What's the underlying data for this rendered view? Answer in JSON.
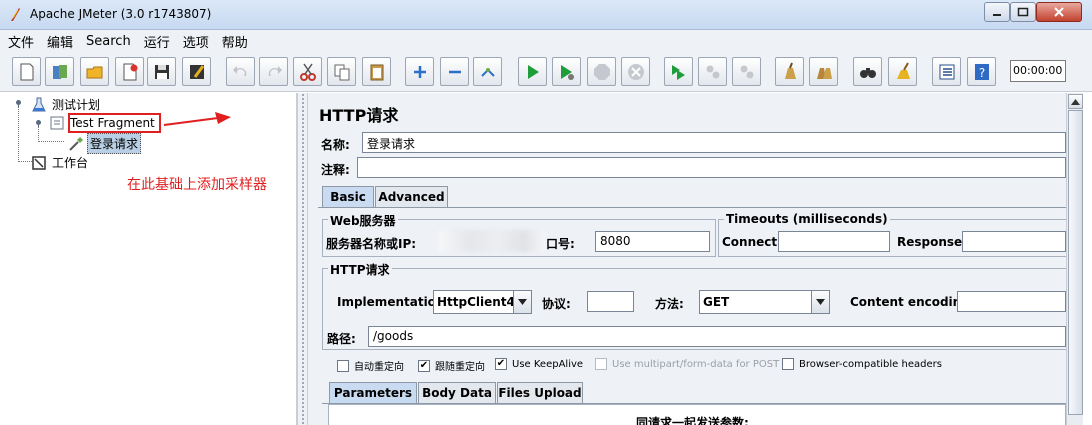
{
  "window": {
    "title": "Apache JMeter (3.0 r1743807)"
  },
  "menu": [
    "文件",
    "编辑",
    "Search",
    "运行",
    "选项",
    "帮助"
  ],
  "toolbar": {
    "timer": "00:00:00"
  },
  "tree": {
    "root": "测试计划",
    "fragment": "Test Fragment",
    "sampler": "登录请求",
    "workbench": "工作台"
  },
  "annotation": "在此基础上添加采样器",
  "panel": {
    "title": "HTTP请求",
    "name_label": "名称:",
    "name_value": "登录请求",
    "comment_label": "注释:",
    "comment_value": "",
    "tabs": [
      "Basic",
      "Advanced"
    ],
    "active_tab": "Basic",
    "web_server": {
      "title": "Web服务器",
      "server_label": "服务器名称或IP:",
      "port_label": "端口号:",
      "port_label_visible": "口号:",
      "port_value": "8080"
    },
    "timeouts": {
      "title": "Timeouts (milliseconds)",
      "connect_label": "Connect:",
      "connect_value": "",
      "response_label": "Response:",
      "response_value": ""
    },
    "http_request": {
      "title": "HTTP请求",
      "implementation_label": "Implementation:",
      "implementation_value": "HttpClient4",
      "protocol_label": "协议:",
      "protocol_value": "",
      "method_label": "方法:",
      "method_value": "GET",
      "encoding_label": "Content encoding:",
      "encoding_value": "",
      "path_label": "路径:",
      "path_value": "/goods"
    },
    "checkboxes": [
      {
        "label": "自动重定向",
        "checked": false,
        "enabled": true
      },
      {
        "label": "跟随重定向",
        "checked": true,
        "enabled": true
      },
      {
        "label": "Use KeepAlive",
        "checked": true,
        "enabled": true
      },
      {
        "label": "Use multipart/form-data for POST",
        "checked": false,
        "enabled": false
      },
      {
        "label": "Browser-compatible headers",
        "checked": false,
        "enabled": true
      }
    ],
    "sub_tabs": [
      "Parameters",
      "Body Data",
      "Files Upload"
    ],
    "active_sub_tab": "Parameters",
    "params_caption": "同请求一起发送参数:"
  }
}
